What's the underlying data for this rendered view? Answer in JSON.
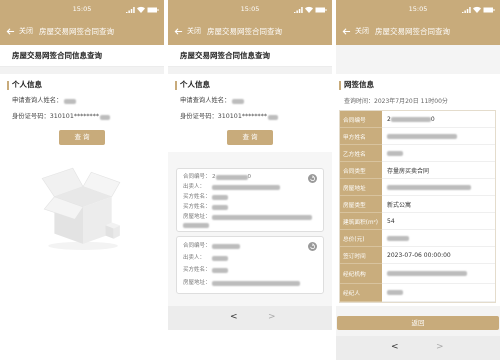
{
  "status_bar": {
    "time": "15:05",
    "icons": [
      "signal-icon",
      "wifi-icon",
      "battery-icon"
    ]
  },
  "header": {
    "back_icon": "arrow-left-icon",
    "close_label": "关闭",
    "title": "房屋交易网签合同查询"
  },
  "theme": {
    "brand_gold": "#c8ab7b",
    "label_gold": "#c9ad7d",
    "page_background": "#f4f4f4"
  },
  "query_page": {
    "page_title": "房屋交易网签合同信息查询",
    "section_title": "个人信息",
    "name_label": "申请查询人姓名：",
    "id_label": "身份证号码：",
    "id_value": "310101********",
    "query_button": "查 询"
  },
  "empty_state": {
    "icon": "empty-box-icon"
  },
  "contract_list": {
    "cards": [
      {
        "contract_no_prefix": "2",
        "contract_no_suffix": "0",
        "action_icon": "circle-arrow-icon",
        "fields": [
          {
            "label": "合同编号："
          },
          {
            "label": "出卖人："
          },
          {
            "label": "买方姓名："
          },
          {
            "label": "买方姓名："
          },
          {
            "label": "房屋地址："
          }
        ]
      },
      {
        "action_icon": "circle-arrow-icon",
        "fields": [
          {
            "label": "合同编号："
          },
          {
            "label": "出卖人："
          },
          {
            "label": "买方姓名："
          },
          {
            "label": "房屋地址："
          }
        ]
      }
    ],
    "pager": {
      "prev": "<",
      "next": ">"
    }
  },
  "detail_page": {
    "section_title": "网签信息",
    "query_time_label": "查询时间：",
    "query_time_value": "2023年7月20日 11时00分",
    "rows": [
      {
        "label": "合同编号",
        "value_prefix": "2",
        "value_suffix": "0"
      },
      {
        "label": "甲方姓名"
      },
      {
        "label": "乙方姓名"
      },
      {
        "label": "合同类型",
        "value": "存量房买卖合同"
      },
      {
        "label": "房屋地址"
      },
      {
        "label": "房屋类型",
        "value": "新式公寓"
      },
      {
        "label": "建筑面积(m²)",
        "value": "54"
      },
      {
        "label": "总价(元)"
      },
      {
        "label": "签订时间",
        "value": "2023-07-06 00:00:00"
      },
      {
        "label": "经纪机构"
      },
      {
        "label": "经纪人"
      }
    ],
    "return_button": "返回",
    "pager": {
      "prev": "<",
      "next": ">"
    }
  }
}
